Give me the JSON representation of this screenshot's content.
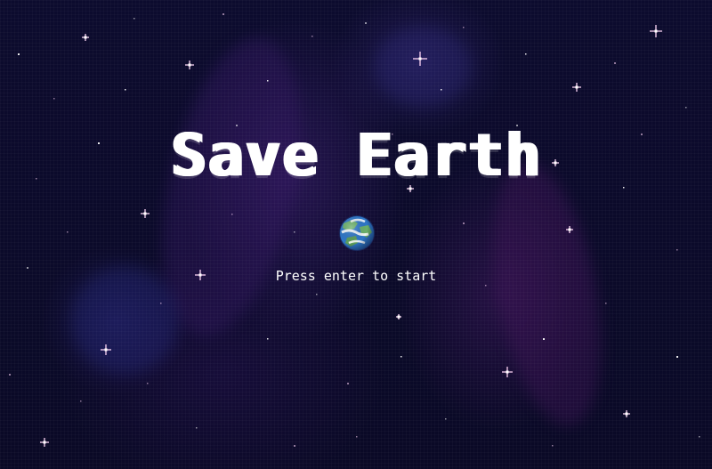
{
  "game": {
    "title": "Save Earth",
    "prompt": "Press enter to start"
  },
  "icons": {
    "emblem": "earth-planet-icon"
  },
  "colors": {
    "background": "#0b0a2a",
    "text": "#ffffff",
    "star": "#ffd6f7",
    "ocean": "#2f77c8",
    "land": "#6bb06a",
    "cloud": "#ffffff"
  }
}
